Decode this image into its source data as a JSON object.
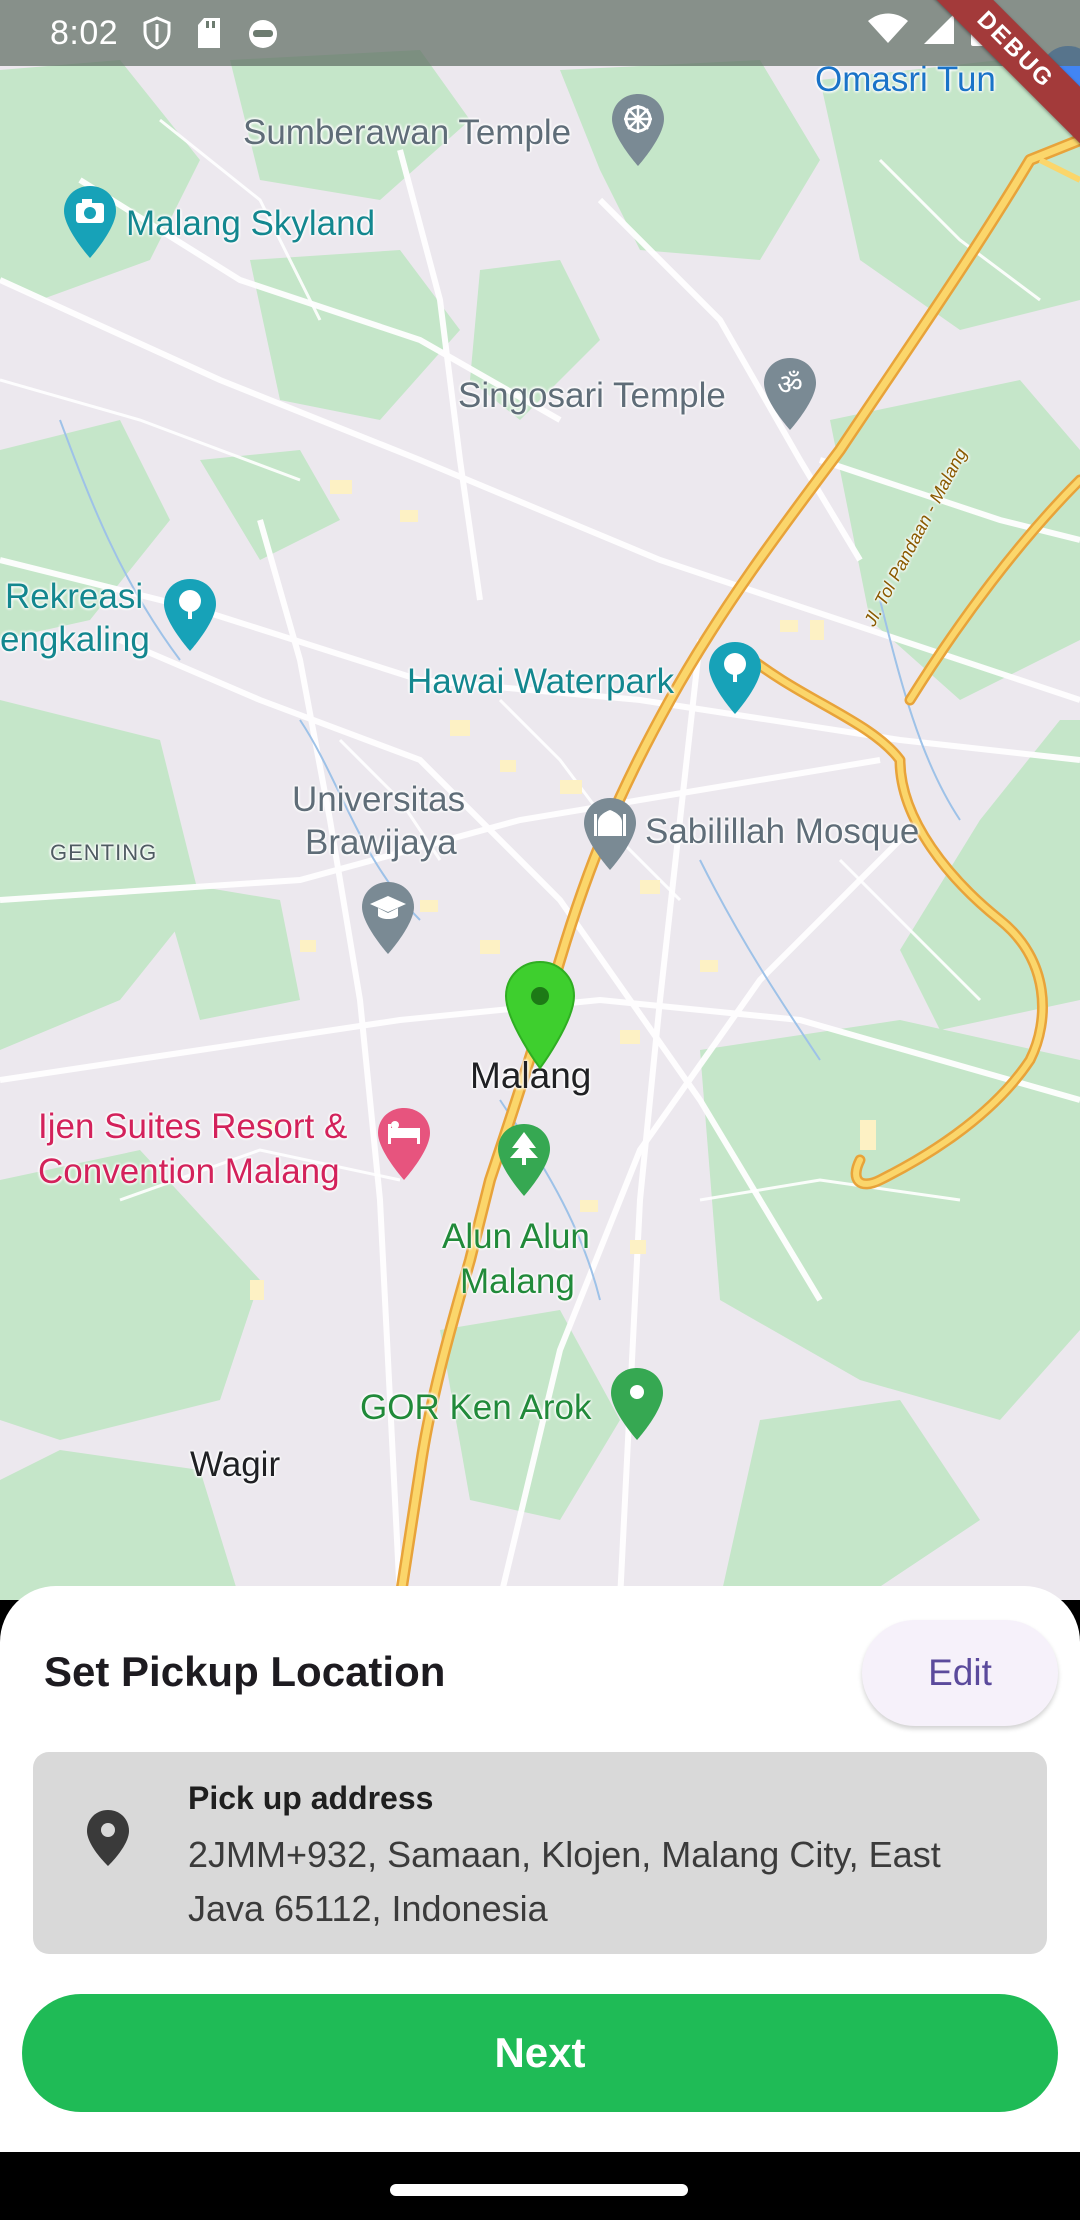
{
  "status_bar": {
    "time": "8:02",
    "left_icons": [
      "shield-icon",
      "sd-card-icon",
      "cat-face-icon"
    ],
    "right_icons": [
      "wifi-icon",
      "cellular-icon",
      "battery-icon"
    ],
    "debug_ribbon": "DEBUG"
  },
  "map": {
    "places": {
      "omasri": "Omasri Tun",
      "sumberawan": "Sumberawan Temple",
      "skyland": "Malang Skyland",
      "singosari": "Singosari Temple",
      "rekreasi_1": "Rekreasi",
      "rekreasi_2": "engkaling",
      "hawai": "Hawai Waterpark",
      "univ_1": "Universitas",
      "univ_2": "Brawijaya",
      "genting": "GENTING",
      "mosque": "Sabilillah Mosque",
      "city": "Malang",
      "ijen_1": "Ijen Suites Resort &",
      "ijen_2": "Convention Malang",
      "alun_1": "Alun Alun",
      "alun_2": "Malang",
      "gor": "GOR Ken Arok",
      "wagir": "Wagir",
      "toll_road": "Jl. Tol Pandaan - Malang"
    },
    "selected_pin_color": "#3ecf2e"
  },
  "sheet": {
    "title": "Set Pickup Location",
    "edit_label": "Edit",
    "address_label": "Pick up address",
    "address_value": "2JMM+932, Samaan, Klojen, Malang City, East Java 65112, Indonesia",
    "next_label": "Next"
  },
  "colors": {
    "primary_green": "#1fbb56",
    "edit_text": "#5b4a9c",
    "card_bg": "#d9d9d9"
  }
}
